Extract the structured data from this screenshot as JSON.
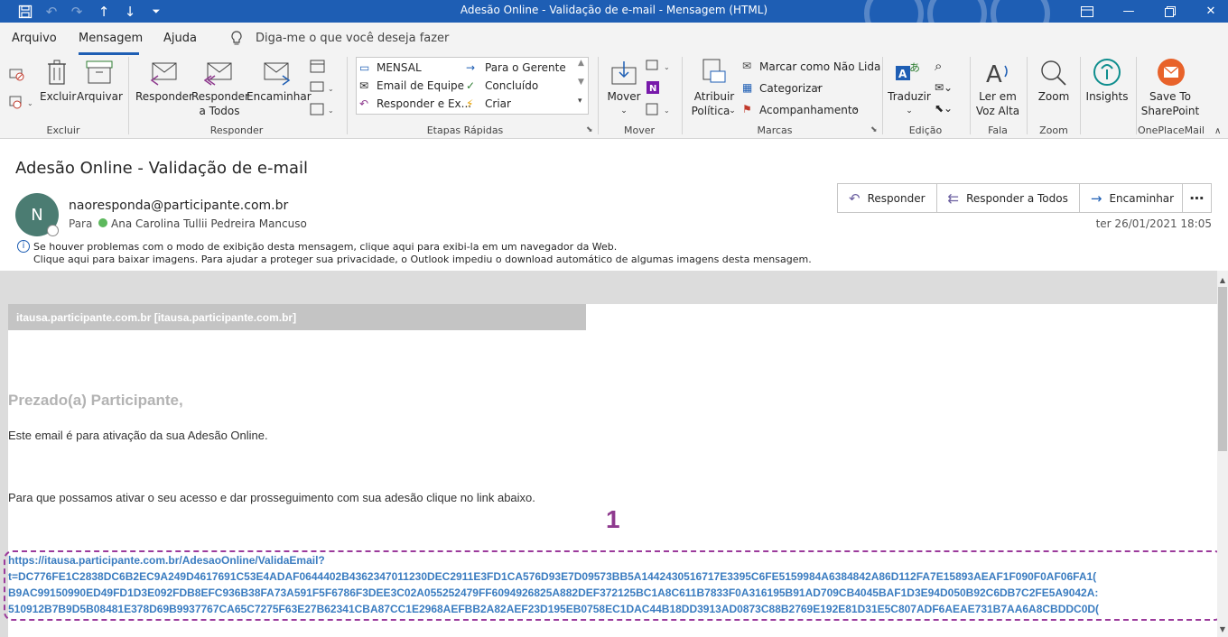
{
  "window": {
    "title": "Adesão Online - Validação de e-mail  -  Mensagem (HTML)"
  },
  "menu": {
    "items": [
      "Arquivo",
      "Mensagem",
      "Ajuda"
    ],
    "tell_me": "Diga-me o que você deseja fazer"
  },
  "ribbon": {
    "excluir": {
      "delete": "Excluir",
      "archive": "Arquivar",
      "group": "Excluir"
    },
    "responder": {
      "reply": "Responder",
      "reply_all_1": "Responder",
      "reply_all_2": "a Todos",
      "forward": "Encaminhar",
      "group": "Responder"
    },
    "quick_steps": {
      "items": [
        "MENSAL",
        "Email de Equipe",
        "Responder e Ex...",
        "Para o Gerente",
        "Concluído",
        "Criar"
      ],
      "group": "Etapas Rápidas"
    },
    "mover": {
      "move": "Mover",
      "group": "Mover"
    },
    "marcas": {
      "policy_1": "Atribuir",
      "policy_2": "Política",
      "unread": "Marcar como Não Lida",
      "categorize": "Categorizar",
      "followup": "Acompanhamento",
      "group": "Marcas"
    },
    "edicao": {
      "translate": "Traduzir",
      "group": "Edição"
    },
    "fala": {
      "read_1": "Ler em",
      "read_2": "Voz Alta",
      "group": "Fala"
    },
    "zoom": {
      "zoom": "Zoom",
      "group": "Zoom"
    },
    "insights": {
      "label": "Insights"
    },
    "oneplace": {
      "save_1": "Save To",
      "save_2": "SharePoint",
      "group": "OnePlaceMail"
    }
  },
  "message": {
    "subject": "Adesão Online - Validação de e-mail",
    "avatar_letter": "N",
    "sender": "naoresponda@participante.com.br",
    "to_label": "Para",
    "to_name": "Ana Carolina Tullii Pedreira Mancuso",
    "date": "ter 26/01/2021 18:05",
    "actions": {
      "reply": "Responder",
      "reply_all": "Responder a Todos",
      "forward": "Encaminhar"
    },
    "info_line1": "Se houver problemas com o modo de exibição desta mensagem, clique aqui para exibi-la em um navegador da Web.",
    "info_line2": "Clique aqui para baixar imagens. Para ajudar a proteger sua privacidade, o Outlook impediu o download automático de algumas imagens desta mensagem."
  },
  "body": {
    "site_bar": "itausa.participante.com.br [itausa.participante.com.br]",
    "greeting": "Prezado(a) Participante,",
    "paragraph1": "Este email é para ativação da sua Adesão Online.",
    "paragraph2": "Para que possamos ativar o seu acesso e dar prosseguimento com sua adesão clique no link abaixo.",
    "annotation_number": "1",
    "link_lines": [
      "https://itausa.participante.com.br/AdesaoOnline/ValidaEmail?",
      "t=DC776FE1C2838DC6B2EC9A249D4617691C53E4ADAF0644402B4362347011230DEC2911E3FD1CA576D93E7D09573BB5A1442430516717E3395C6FE5159984A6384842A86D112FA7E15893AEAF1F090F0AF06FA1(",
      "B9AC99150990ED49FD1D3E092FDB8EFC936B38FA73A591F5F6786F3DEE3C02A055252479FF6094926825A882DEF372125BC1A8C611B7833F0A316195B91AD709CB4045BAF1D3E94D050B92C6DB7C2FE5A9042A:",
      "510912B7B9D5B08481E378D69B9937767CA65C7275F63E27B62341CBA87CC1E2968AEFBB2A82AEF23D195EB0758EC1DAC44B18DD3913AD0873C88B2769E192E81D31E5C807ADF6AEAE731B7AA6A8CBDDC0D("
    ]
  },
  "colors": {
    "titlebar": "#1e5eb4",
    "link": "#3a7cc0",
    "annotation": "#8e3a8e"
  }
}
